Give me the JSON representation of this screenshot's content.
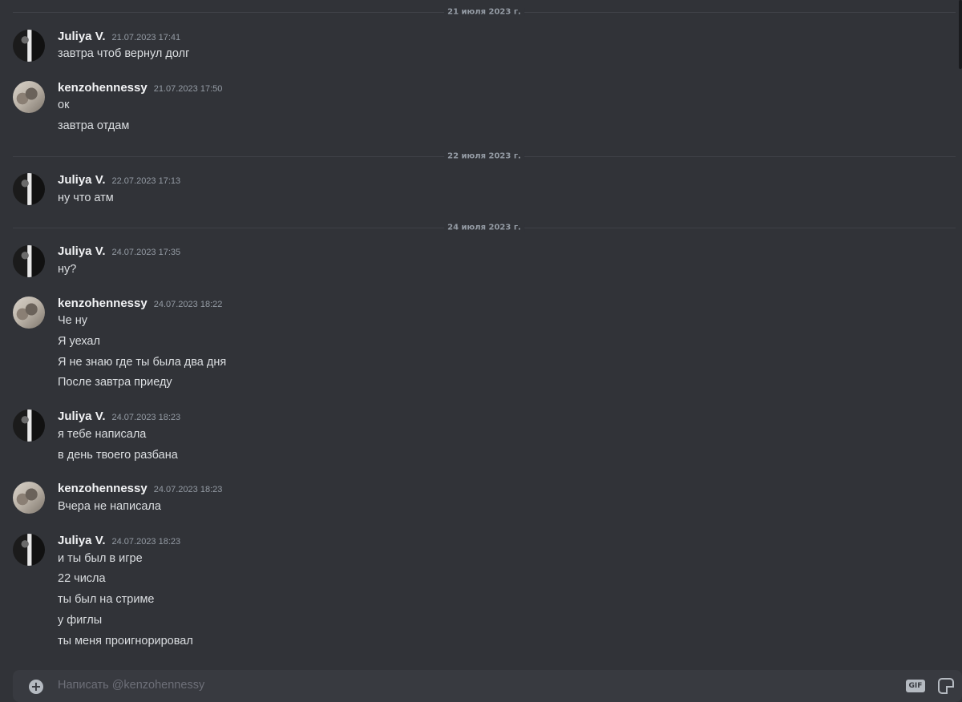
{
  "dividers": [
    "21 июля 2023 г.",
    "22 июля 2023 г.",
    "24 июля 2023 г."
  ],
  "messages": [
    {
      "author": "Juliya V.",
      "time": "21.07.2023 17:41",
      "lines": [
        "завтра чтоб вернул долг"
      ]
    },
    {
      "author": "kenzohennessy",
      "time": "21.07.2023 17:50",
      "lines": [
        "ок",
        "завтра отдам"
      ]
    },
    {
      "author": "Juliya V.",
      "time": "22.07.2023 17:13",
      "lines": [
        "ну что атм"
      ]
    },
    {
      "author": "Juliya V.",
      "time": "24.07.2023 17:35",
      "lines": [
        "ну?"
      ]
    },
    {
      "author": "kenzohennessy",
      "time": "24.07.2023 18:22",
      "lines": [
        "Че ну",
        "Я уехал",
        "Я не знаю где ты была два дня",
        "После завтра приеду"
      ]
    },
    {
      "author": "Juliya V.",
      "time": "24.07.2023 18:23",
      "lines": [
        "я тебе написала",
        "в день твоего разбана"
      ]
    },
    {
      "author": "kenzohennessy",
      "time": "24.07.2023 18:23",
      "lines": [
        "Вчера не написала"
      ]
    },
    {
      "author": "Juliya V.",
      "time": "24.07.2023 18:23",
      "lines": [
        "и ты был в игре",
        "22 числа",
        "ты был на стриме",
        "у фиглы",
        "ты меня проигнорировал"
      ]
    }
  ],
  "composer": {
    "placeholder": "Написать @kenzohennessy",
    "gif_label": "GIF",
    "icons": {
      "attach": "plus-circle-icon",
      "gif": "gif-icon",
      "sticker": "sticker-icon"
    }
  },
  "colors": {
    "background": "#313338",
    "composer": "#383a40",
    "author": "#f2f3f5",
    "text": "#dbdee1",
    "muted": "#949ba4"
  }
}
